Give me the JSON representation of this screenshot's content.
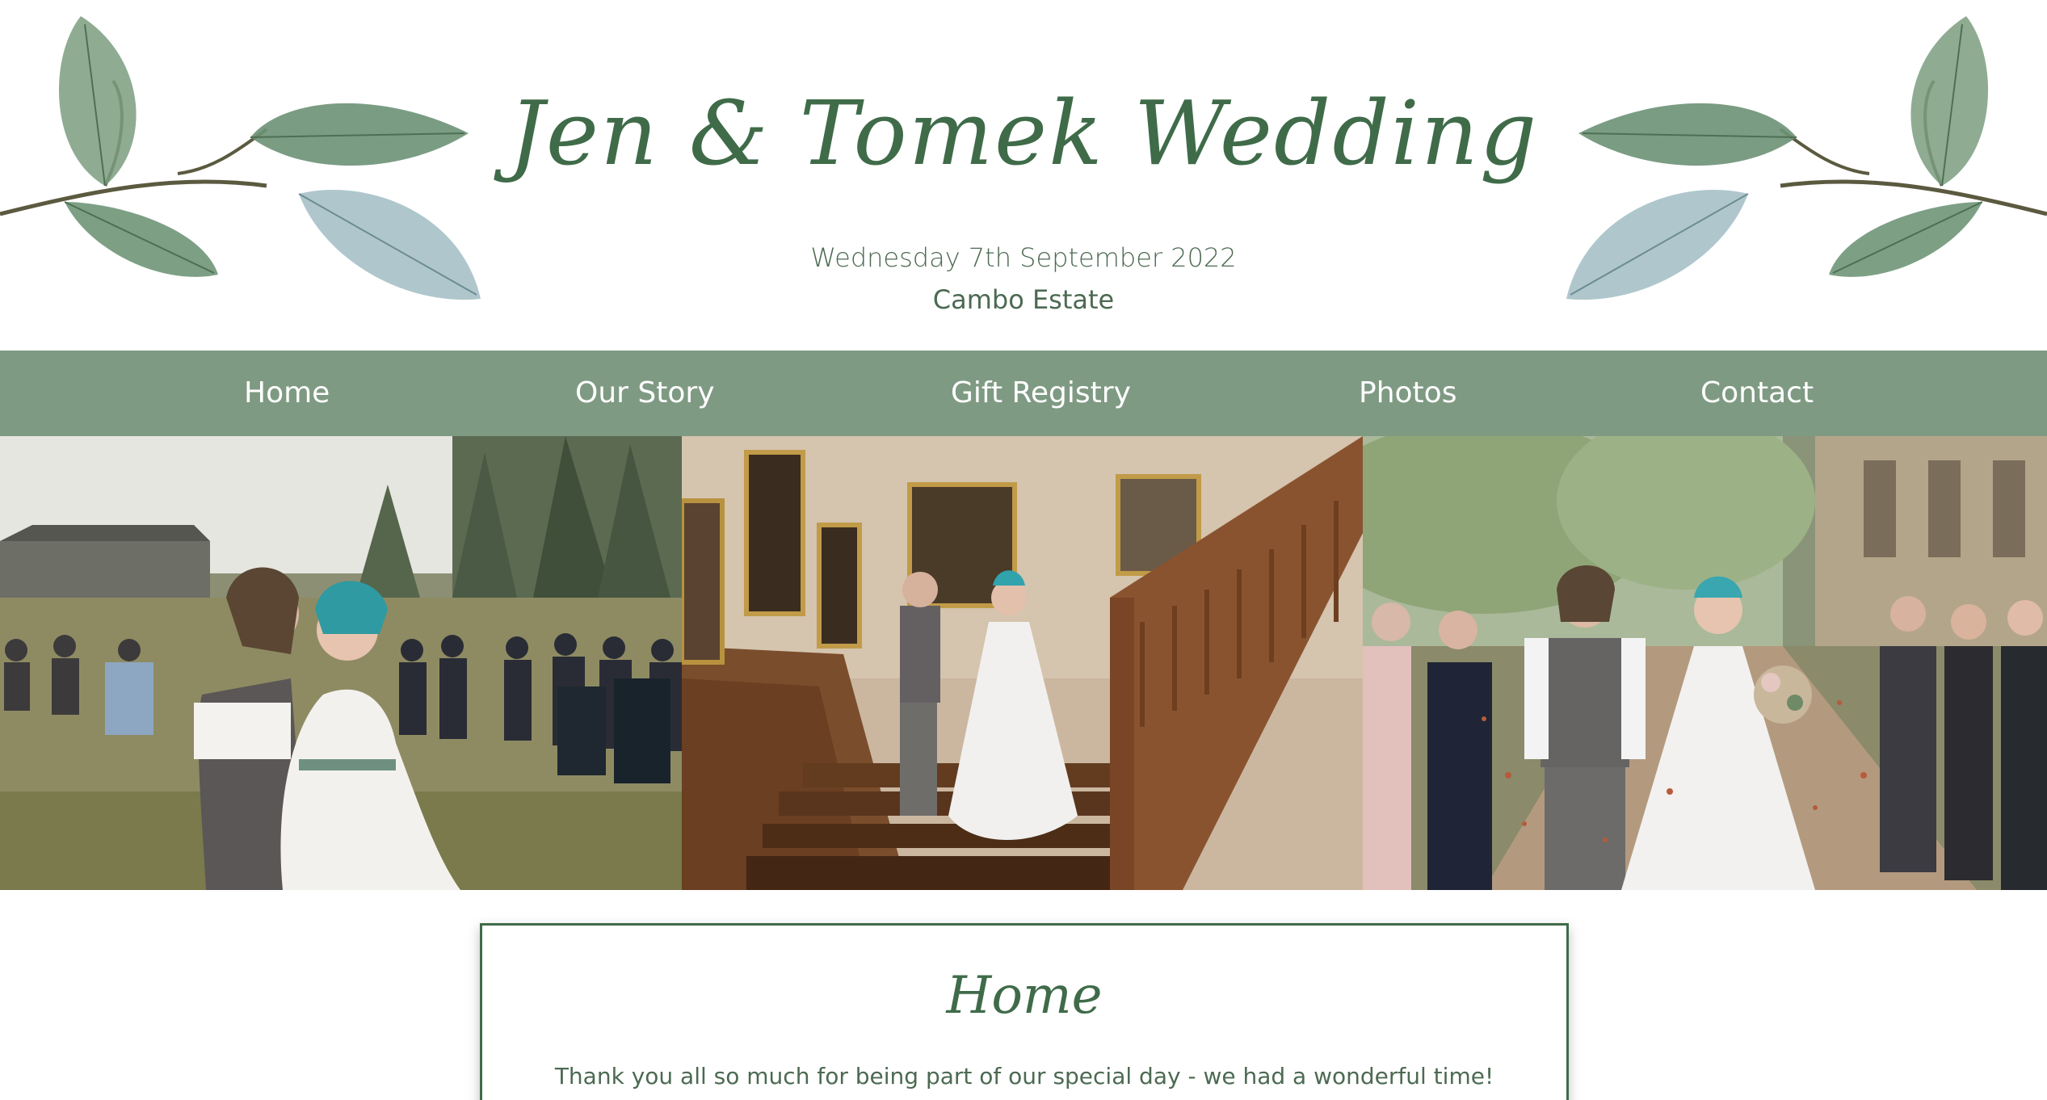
{
  "header": {
    "title": "Jen & Tomek Wedding",
    "date": "Wednesday 7th September 2022",
    "venue": "Cambo Estate"
  },
  "nav": {
    "items": [
      {
        "label": "Home"
      },
      {
        "label": "Our Story"
      },
      {
        "label": "Gift Registry"
      },
      {
        "label": "Photos"
      },
      {
        "label": "Contact"
      }
    ]
  },
  "photos": [
    {
      "subject": "couple embracing at outdoor ceremony"
    },
    {
      "subject": "couple walking down wooden staircase"
    },
    {
      "subject": "couple walking through confetti"
    }
  ],
  "content": {
    "heading": "Home",
    "text": "Thank you all so much for being part of our special day - we had a wonderful time!"
  },
  "colors": {
    "primary_green": "#3f6b49",
    "nav_background": "#7f9a83",
    "text_green": "#4c6a52",
    "background": "#ffffff"
  }
}
